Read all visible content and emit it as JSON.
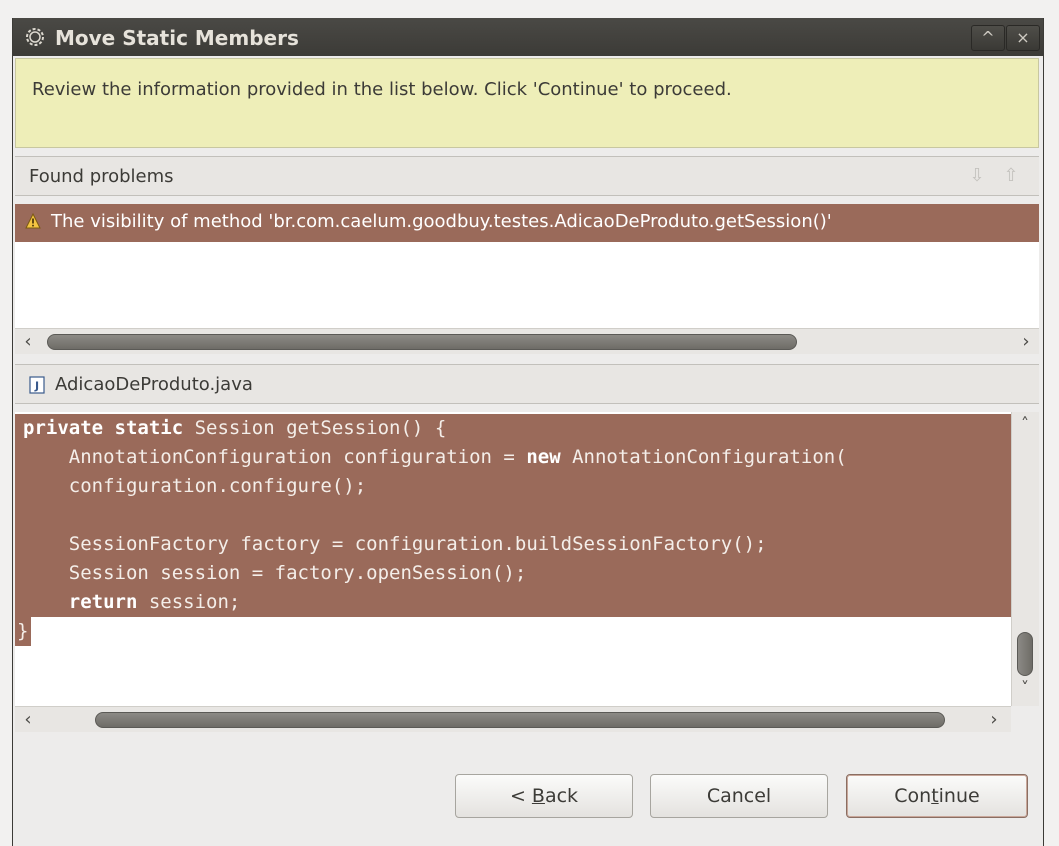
{
  "window": {
    "title": "Move Static Members",
    "maximize_glyph": "^",
    "close_glyph": "×"
  },
  "info": {
    "message": "Review the information provided in the list below. Click 'Continue' to proceed."
  },
  "problems": {
    "header": "Found problems",
    "items": [
      "The visibility of method 'br.com.caelum.goodbuy.testes.AdicaoDeProduto.getSession()'"
    ]
  },
  "file": {
    "name": "AdicaoDeProduto.java"
  },
  "code": {
    "lines": [
      {
        "kw": "private static",
        "rest": " Session getSession() {"
      },
      {
        "pre": "    AnnotationConfiguration configuration = ",
        "kw": "new",
        "rest": " AnnotationConfiguration("
      },
      {
        "pre": "    configuration.configure();"
      },
      {
        "pre": ""
      },
      {
        "pre": "    SessionFactory factory = configuration.buildSessionFactory();"
      },
      {
        "pre": "    Session session = factory.openSession();"
      },
      {
        "pre": "    ",
        "kw": "return",
        "rest": " session;"
      },
      {
        "pre": "}"
      }
    ]
  },
  "buttons": {
    "back_prefix": "< ",
    "back_mnemonic": "B",
    "back_rest": "ack",
    "cancel": "Cancel",
    "continue_prefix": "Con",
    "continue_mnemonic": "t",
    "continue_rest": "inue"
  },
  "colors": {
    "selection": "#9a6a5a",
    "info_background": "#eeeeb8",
    "titlebar": "#3c3b37"
  }
}
